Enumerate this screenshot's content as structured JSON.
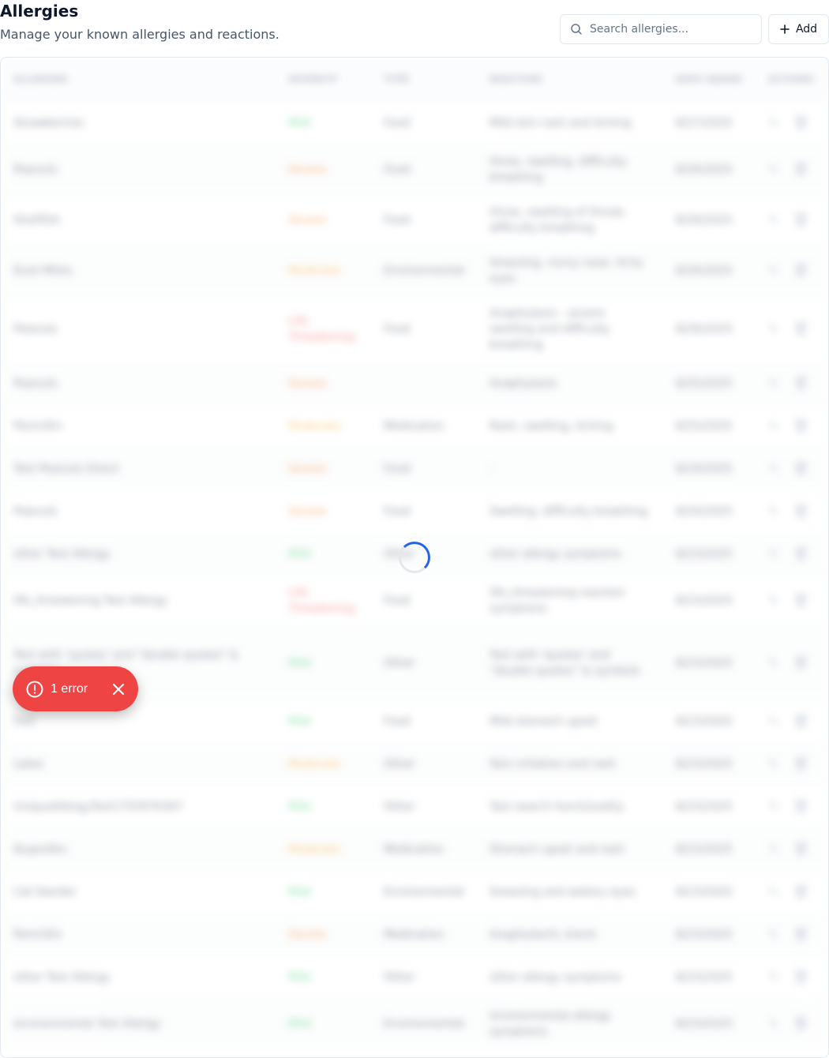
{
  "header": {
    "title": "Allergies",
    "subtitle": "Manage your known allergies and reactions."
  },
  "search": {
    "placeholder": "Search allergies..."
  },
  "toolbar": {
    "add_label": "Add"
  },
  "table": {
    "columns": [
      "ALLERGEN",
      "SEVERITY",
      "TYPE",
      "REACTION",
      "DATE ADDED",
      "ACTIONS"
    ],
    "rows": [
      {
        "allergen": "Strawberries",
        "severity": "Mild",
        "sev": "mild",
        "type": "Food",
        "reaction": "Mild skin rash and itching",
        "date": "8/27/2025"
      },
      {
        "allergen": "Peanuts",
        "severity": "Severe",
        "sev": "severe",
        "type": "Food",
        "reaction": "Hives, swelling, difficulty breathing",
        "date": "8/26/2025"
      },
      {
        "allergen": "Shellfish",
        "severity": "Severe",
        "sev": "severe",
        "type": "Food",
        "reaction": "Hives, swelling of throat, difficulty breathing",
        "date": "8/26/2025"
      },
      {
        "allergen": "Dust Mites",
        "severity": "Moderate",
        "sev": "moderate",
        "type": "Environmental",
        "reaction": "Sneezing, runny nose, itchy eyes",
        "date": "8/26/2025"
      },
      {
        "allergen": "Peanuts",
        "severity": "Life Threatening",
        "sev": "life",
        "type": "Food",
        "reaction": "Anaphylaxis - severe swelling and difficulty breathing",
        "date": "8/26/2025"
      },
      {
        "allergen": "Peanuts",
        "severity": "Severe",
        "sev": "severe",
        "type": "",
        "reaction": "Anaphylaxis",
        "date": "8/25/2025"
      },
      {
        "allergen": "Penicillin",
        "severity": "Moderate",
        "sev": "moderate",
        "type": "Medication",
        "reaction": "Rash, swelling, itching",
        "date": "8/25/2025"
      },
      {
        "allergen": "Test Peanuts Direct",
        "severity": "Severe",
        "sev": "severe",
        "type": "Food",
        "reaction": "-",
        "date": "8/24/2025"
      },
      {
        "allergen": "Peanuts",
        "severity": "Severe",
        "sev": "severe",
        "type": "Food",
        "reaction": "Swelling, difficulty breathing",
        "date": "8/24/2025"
      },
      {
        "allergen": "other Test Allergy",
        "severity": "Mild",
        "sev": "mild",
        "type": "Other",
        "reaction": "other allergy symptoms",
        "date": "8/23/2025"
      },
      {
        "allergen": "life_threatening Test Allergy",
        "severity": "Life Threatening",
        "sev": "life",
        "type": "Food",
        "reaction": "life_threatening reaction symptoms",
        "date": "8/23/2025"
      },
      {
        "allergen": "Test with 'quotes' and \"double quotes\" & symbols",
        "severity": "Mild",
        "sev": "mild",
        "type": "Other",
        "reaction": "Test with 'quotes' and \"double quotes\" & symbols",
        "date": "8/23/2025"
      },
      {
        "allergen": "Fish",
        "severity": "Mild",
        "sev": "mild",
        "type": "Food",
        "reaction": "Mild stomach upset",
        "date": "8/23/2025"
      },
      {
        "allergen": "Latex",
        "severity": "Moderate",
        "sev": "moderate",
        "type": "Other",
        "reaction": "Skin irritation and rash",
        "date": "8/23/2025"
      },
      {
        "allergen": "UniqueAllergyTest1755976367",
        "severity": "Mild",
        "sev": "mild",
        "type": "Other",
        "reaction": "Test search functionality",
        "date": "8/23/2025"
      },
      {
        "allergen": "Ibuprofen",
        "severity": "Moderate",
        "sev": "moderate",
        "type": "Medication",
        "reaction": "Stomach upset and rash",
        "date": "8/23/2025"
      },
      {
        "allergen": "Cat Dander",
        "severity": "Mild",
        "sev": "mild",
        "type": "Environmental",
        "reaction": "Sneezing and watery eyes",
        "date": "8/23/2025"
      },
      {
        "allergen": "Penicillin",
        "severity": "Severe",
        "sev": "severe",
        "type": "Medication",
        "reaction": "Anaphylactic shock",
        "date": "8/23/2025"
      },
      {
        "allergen": "other Test Allergy",
        "severity": "Mild",
        "sev": "mild",
        "type": "Other",
        "reaction": "other allergy symptoms",
        "date": "8/23/2025"
      },
      {
        "allergen": "environmental Test Allergy",
        "severity": "Mild",
        "sev": "mild",
        "type": "Environmental",
        "reaction": "environmental allergy symptoms",
        "date": "8/23/2025"
      }
    ]
  },
  "toast": {
    "label": "1 error"
  },
  "colors": {
    "accent": "#2563eb",
    "error": "#ef4444",
    "mild": "#22c55e",
    "moderate": "#f59e0b",
    "severe": "#f97316",
    "life_threatening": "#ef4444"
  },
  "icons": {
    "search": "search-icon",
    "add": "plus-icon",
    "edit": "pencil-icon",
    "delete": "trash-icon",
    "error": "alert-circle-icon",
    "close": "close-icon"
  }
}
